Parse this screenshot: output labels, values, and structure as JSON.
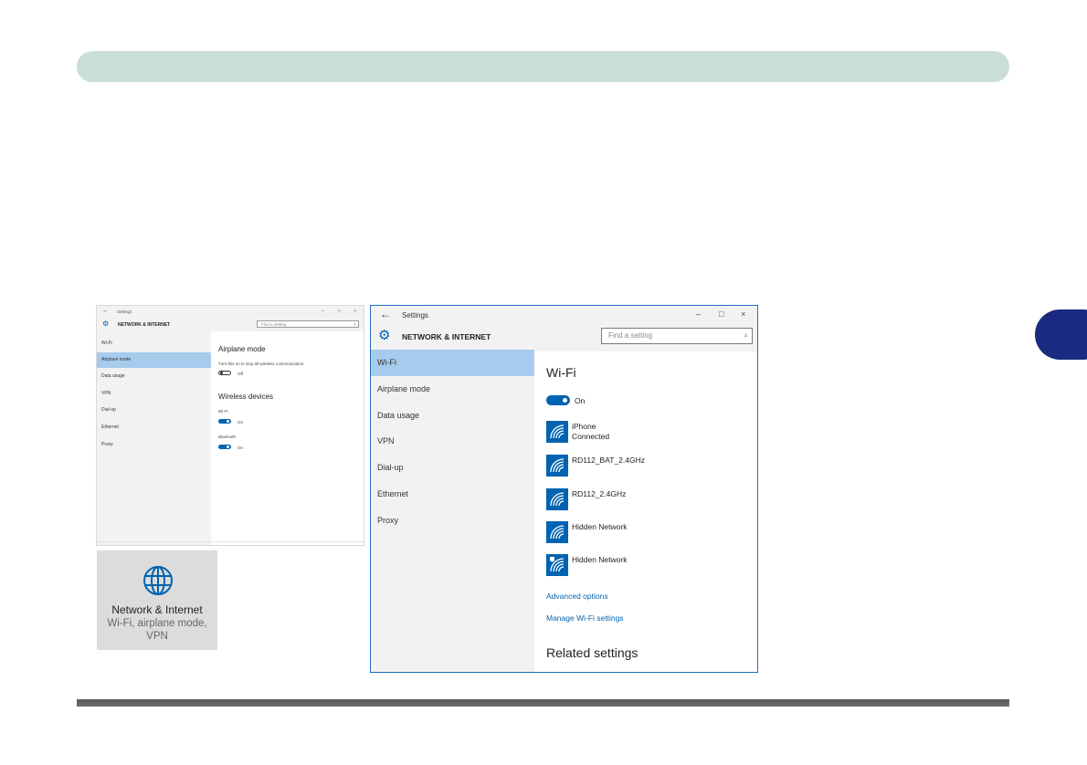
{
  "small_window": {
    "title": "Settings",
    "minimize": "–",
    "maximize": "□",
    "close": "×",
    "header_title": "NETWORK & INTERNET",
    "search_placeholder": "Find a setting",
    "sidebar": [
      {
        "label": "Wi-Fi",
        "selected": false
      },
      {
        "label": "Airplane mode",
        "selected": true
      },
      {
        "label": "Data usage",
        "selected": false
      },
      {
        "label": "VPN",
        "selected": false
      },
      {
        "label": "Dial-up",
        "selected": false
      },
      {
        "label": "Ethernet",
        "selected": false
      },
      {
        "label": "Proxy",
        "selected": false
      }
    ],
    "airplane_heading": "Airplane mode",
    "airplane_desc": "Turn this on to stop all wireless communication.",
    "airplane_state": "Off",
    "wireless_heading": "Wireless devices",
    "wifi_label": "Wi-Fi",
    "wifi_state": "On",
    "bluetooth_label": "Bluetooth",
    "bluetooth_state": "On"
  },
  "tile": {
    "icon": "globe-icon",
    "title": "Network & Internet",
    "subtitle_line1": "Wi-Fi, airplane mode,",
    "subtitle_line2": "VPN"
  },
  "big_window": {
    "title": "Settings",
    "minimize": "–",
    "maximize": "□",
    "close": "×",
    "header_title": "NETWORK & INTERNET",
    "search_placeholder": "Find a setting",
    "sidebar": [
      {
        "label": "Wi-Fi",
        "selected": true
      },
      {
        "label": "Airplane mode",
        "selected": false
      },
      {
        "label": "Data usage",
        "selected": false
      },
      {
        "label": "VPN",
        "selected": false
      },
      {
        "label": "Dial-up",
        "selected": false
      },
      {
        "label": "Ethernet",
        "selected": false
      },
      {
        "label": "Proxy",
        "selected": false
      }
    ],
    "wifi_heading": "Wi-Fi",
    "wifi_state": "On",
    "networks": [
      {
        "name": "iPhone",
        "status": "Connected",
        "secured": false
      },
      {
        "name": "RD112_BAT_2.4GHz",
        "status": "",
        "secured": false
      },
      {
        "name": "RD112_2.4GHz",
        "status": "",
        "secured": false
      },
      {
        "name": "Hidden Network",
        "status": "",
        "secured": false
      },
      {
        "name": "Hidden Network",
        "status": "",
        "secured": true
      }
    ],
    "advanced_options": "Advanced options",
    "manage_wifi": "Manage Wi-Fi settings",
    "related_heading": "Related settings"
  },
  "colors": {
    "accent": "#0063b1",
    "selected_item": "#a7cbed",
    "header_bar": "#c9ded9",
    "chapter_tab": "#1a2a80"
  }
}
